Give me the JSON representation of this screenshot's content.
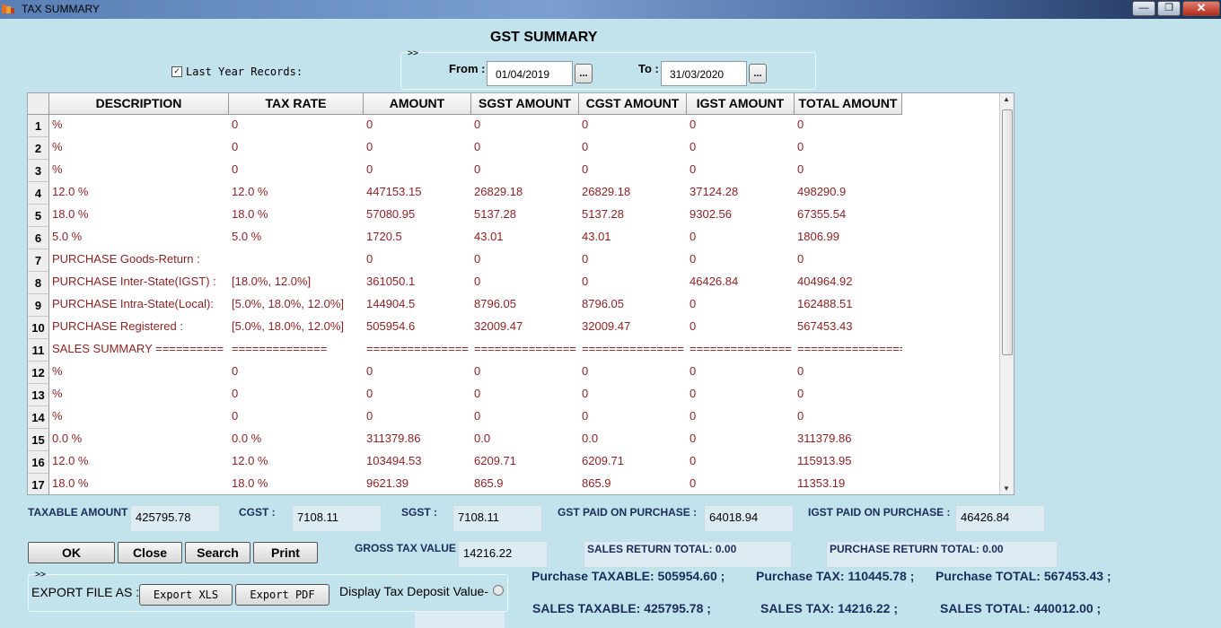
{
  "window": {
    "title": "TAX SUMMARY",
    "minimize": "—",
    "restore": "❐",
    "close": "✕"
  },
  "header": {
    "title": "GST SUMMARY",
    "last_year_label": "Last Year Records:",
    "last_year_checked": "✓"
  },
  "date_range": {
    "arrows": ">>",
    "from_label": "From :",
    "from_value": "01/04/2019",
    "to_label": "To :",
    "to_value": "31/03/2020",
    "picker": "..."
  },
  "table": {
    "columns": [
      "DESCRIPTION",
      "TAX RATE",
      "AMOUNT",
      "SGST AMOUNT",
      "CGST AMOUNT",
      "IGST AMOUNT",
      "TOTAL AMOUNT"
    ],
    "rows": [
      {
        "num": "1",
        "cells": [
          "%",
          "0",
          "0",
          "0",
          "0",
          "0",
          "0"
        ]
      },
      {
        "num": "2",
        "cells": [
          "%",
          "0",
          "0",
          "0",
          "0",
          "0",
          "0"
        ]
      },
      {
        "num": "3",
        "cells": [
          "%",
          "0",
          "0",
          "0",
          "0",
          "0",
          "0"
        ]
      },
      {
        "num": "4",
        "cells": [
          "12.0 %",
          "12.0 %",
          "447153.15",
          "26829.18",
          "26829.18",
          "37124.28",
          "498290.9"
        ]
      },
      {
        "num": "5",
        "cells": [
          "18.0 %",
          "18.0 %",
          "57080.95",
          "5137.28",
          "5137.28",
          "9302.56",
          "67355.54"
        ]
      },
      {
        "num": "6",
        "cells": [
          "5.0 %",
          "5.0 %",
          "1720.5",
          "43.01",
          "43.01",
          "0",
          "1806.99"
        ]
      },
      {
        "num": "7",
        "cells": [
          "PURCHASE Goods-Return :",
          "",
          "0",
          "0",
          "0",
          "0",
          "0"
        ]
      },
      {
        "num": "8",
        "cells": [
          "PURCHASE Inter-State(IGST) :",
          "[18.0%, 12.0%]",
          "361050.1",
          "0",
          "0",
          "46426.84",
          "404964.92"
        ]
      },
      {
        "num": "9",
        "cells": [
          "PURCHASE Intra-State(Local):",
          "[5.0%, 18.0%, 12.0%]",
          "144904.5",
          "8796.05",
          "8796.05",
          "0",
          "162488.51"
        ]
      },
      {
        "num": "10",
        "cells": [
          "PURCHASE Registered :",
          "[5.0%, 18.0%, 12.0%]",
          "505954.6",
          "32009.47",
          "32009.47",
          "0",
          "567453.43"
        ]
      },
      {
        "num": "11",
        "cells": [
          "SALES SUMMARY ==========",
          "==============",
          "===============",
          "===============",
          "===============",
          "===============",
          "================"
        ]
      },
      {
        "num": "12",
        "cells": [
          "%",
          "0",
          "0",
          "0",
          "0",
          "0",
          "0"
        ]
      },
      {
        "num": "13",
        "cells": [
          "%",
          "0",
          "0",
          "0",
          "0",
          "0",
          "0"
        ]
      },
      {
        "num": "14",
        "cells": [
          "%",
          "0",
          "0",
          "0",
          "0",
          "0",
          "0"
        ]
      },
      {
        "num": "15",
        "cells": [
          "0.0 %",
          "0.0 %",
          "311379.86",
          "0.0",
          "0.0",
          "0",
          "311379.86"
        ]
      },
      {
        "num": "16",
        "cells": [
          "12.0 %",
          "12.0 %",
          "103494.53",
          "6209.71",
          "6209.71",
          "0",
          "115913.95"
        ]
      },
      {
        "num": "17",
        "cells": [
          "18.0 %",
          "18.0 %",
          "9621.39",
          "865.9",
          "865.9",
          "0",
          "11353.19"
        ]
      }
    ]
  },
  "summary": {
    "taxable_label": "TAXABLE AMOUNT :",
    "taxable_value": "425795.78",
    "cgst_label": "CGST :",
    "cgst_value": "7108.11",
    "sgst_label": "SGST :",
    "sgst_value": "7108.11",
    "gst_paid_label": "GST PAID ON PURCHASE :",
    "gst_paid_value": "64018.94",
    "igst_paid_label": "IGST PAID ON PURCHASE :",
    "igst_paid_value": "46426.84",
    "gross_label": "GROSS TAX VALUE :",
    "gross_value": "14216.22",
    "sales_return": "SALES RETURN TOTAL: 0.00",
    "purchase_return": "PURCHASE RETURN TOTAL: 0.00"
  },
  "buttons": {
    "ok": "OK",
    "close": "Close",
    "search": "Search",
    "print": "Print"
  },
  "export": {
    "arrows": ">>",
    "label": "EXPORT FILE AS :",
    "xls": "Export XLS",
    "pdf": "Export PDF",
    "display_deposit": "Display Tax Deposit Value-"
  },
  "totals": {
    "purchase_taxable": "Purchase TAXABLE: 505954.60 ;",
    "purchase_tax": "Purchase TAX: 110445.78 ;",
    "purchase_total": "Purchase TOTAL: 567453.43 ;",
    "sales_taxable": "SALES TAXABLE: 425795.78 ;",
    "sales_tax": "SALES TAX: 14216.22 ;",
    "sales_total": "SALES TOTAL: 440012.00 ;"
  }
}
